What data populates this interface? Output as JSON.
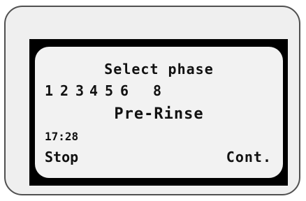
{
  "display": {
    "title": "Select phase",
    "phases": [
      "1",
      "2",
      "3",
      "4",
      "5",
      "6",
      "8"
    ],
    "phase_name": "Pre-Rinse",
    "time": "17:28",
    "left_softkey": "Stop",
    "right_softkey": "Cont."
  }
}
